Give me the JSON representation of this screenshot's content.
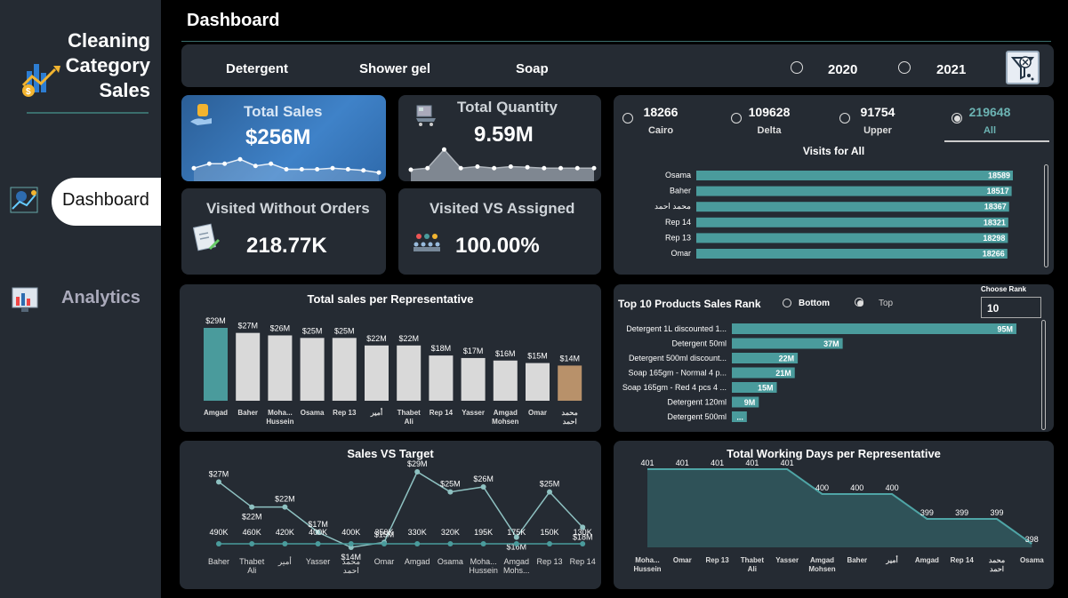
{
  "app": {
    "title_lines": [
      "Cleaning",
      "Category",
      "Sales"
    ]
  },
  "nav": {
    "dashboard": "Dashboard",
    "analytics": "Analytics"
  },
  "page_title": "Dashboard",
  "filters": {
    "categories": [
      "Detergent",
      "Shower gel",
      "Soap"
    ],
    "years": [
      {
        "label": "2020",
        "selected": false
      },
      {
        "label": "2021",
        "selected": false
      }
    ],
    "clear_icon": "clear-filter-icon"
  },
  "kpis": {
    "total_sales": {
      "label": "Total Sales",
      "value": "$256M"
    },
    "total_quantity": {
      "label": "Total Quantity",
      "value": "9.59M"
    },
    "visited_without_orders": {
      "label": "Visited Without Orders",
      "value": "218.77K"
    },
    "visited_vs_assigned": {
      "label": "Visited VS Assigned",
      "value": "100.00%"
    }
  },
  "colors": {
    "teal": "#4a9b9c",
    "sales_blue": "#2e6cb0",
    "accent_tan": "#b8916a",
    "bar_gray": "#d9d9d9",
    "card": "#252b33"
  },
  "regions": [
    {
      "value": "18266",
      "label": "Cairo",
      "selected": false
    },
    {
      "value": "109628",
      "label": "Delta",
      "selected": false
    },
    {
      "value": "91754",
      "label": "Upper",
      "selected": false
    },
    {
      "value": "219648",
      "label": "All",
      "selected": true
    }
  ],
  "chart_data": [
    {
      "type": "bar",
      "title": "Visits for All",
      "orientation": "horizontal",
      "categories": [
        "Osama",
        "Baher",
        "محمد احمد",
        "Rep 14",
        "Rep 13",
        "Omar"
      ],
      "values": [
        18589,
        18517,
        18367,
        18321,
        18298,
        18266
      ],
      "labels": [
        "18589",
        "18517",
        "18367",
        "18321",
        "18298",
        "18266"
      ]
    },
    {
      "type": "bar",
      "title": "Total sales per Representative",
      "categories": [
        "Amgad",
        "Baher",
        "Moha... Hussein",
        "Osama",
        "Rep 13",
        "أمير",
        "Thabet Ali",
        "Rep 14",
        "Yasser",
        "Amgad Mohsen",
        "Omar",
        "محمد احمد"
      ],
      "values": [
        29,
        27,
        26,
        25,
        25,
        22,
        22,
        18,
        17,
        16,
        15,
        14
      ],
      "labels": [
        "$29M",
        "$27M",
        "$26M",
        "$25M",
        "$25M",
        "$22M",
        "$22M",
        "$18M",
        "$17M",
        "$16M",
        "$15M",
        "$14M"
      ],
      "units": "$M"
    },
    {
      "type": "bar",
      "title": "Top 10 Products Sales Rank",
      "orientation": "horizontal",
      "controls": {
        "bottom": "Bottom",
        "top": "Top",
        "selected": "Top",
        "choose_rank_label": "Choose Rank",
        "rank_value": "10"
      },
      "categories": [
        "Detergent 1L discounted 1...",
        "Detergent 50ml",
        "Detergent 500ml discount...",
        "Soap 165gm - Normal 4 p...",
        "Soap 165gm - Red 4 pcs 4 ...",
        "Detergent 120ml",
        "Detergent 500ml"
      ],
      "values": [
        95,
        37,
        22,
        21,
        15,
        9,
        5
      ],
      "labels": [
        "95M",
        "37M",
        "22M",
        "21M",
        "15M",
        "9M",
        "..."
      ]
    },
    {
      "type": "line",
      "title": "Sales VS Target",
      "categories": [
        "Baher",
        "Thabet Ali",
        "أمير",
        "Yasser",
        "محمد احمد",
        "Omar",
        "Amgad",
        "Osama",
        "Moha... Hussein",
        "Amgad Mohs...",
        "Rep 13",
        "Rep 14"
      ],
      "series": [
        {
          "values": [
            27,
            22,
            22,
            17,
            14,
            15,
            29,
            25,
            26,
            16,
            25,
            18
          ],
          "labels": [
            "$27M",
            "$22M",
            "$22M",
            "$17M",
            "$14M",
            "$15M",
            "$29M",
            "$25M",
            "$26M",
            "$16M",
            "$25M",
            "$18M"
          ]
        },
        {
          "values": [
            490,
            460,
            420,
            400,
            400,
            350,
            330,
            320,
            195,
            175,
            150,
            130
          ],
          "labels": [
            "490K",
            "460K",
            "420K",
            "400K",
            "400K",
            "350K",
            "330K",
            "320K",
            "195K",
            "175K",
            "150K",
            "130K"
          ]
        }
      ]
    },
    {
      "type": "area",
      "title": "Total Working Days per Representative",
      "categories": [
        "Moha... Hussein",
        "Omar",
        "Rep 13",
        "Thabet Ali",
        "Yasser",
        "Amgad Mohsen",
        "Baher",
        "أمير",
        "Amgad",
        "Rep 14",
        "محمد احمد",
        "Osama"
      ],
      "values": [
        401,
        401,
        401,
        401,
        401,
        400,
        400,
        400,
        399,
        399,
        399,
        398
      ]
    }
  ],
  "sparklines": {
    "total_sales": [
      0.35,
      0.55,
      0.55,
      0.75,
      0.45,
      0.55,
      0.3,
      0.3,
      0.3,
      0.35,
      0.3,
      0.25,
      0.15
    ],
    "total_quantity": [
      0.2,
      0.25,
      0.85,
      0.25,
      0.3,
      0.25,
      0.3,
      0.28,
      0.25,
      0.25,
      0.25,
      0.25
    ]
  }
}
